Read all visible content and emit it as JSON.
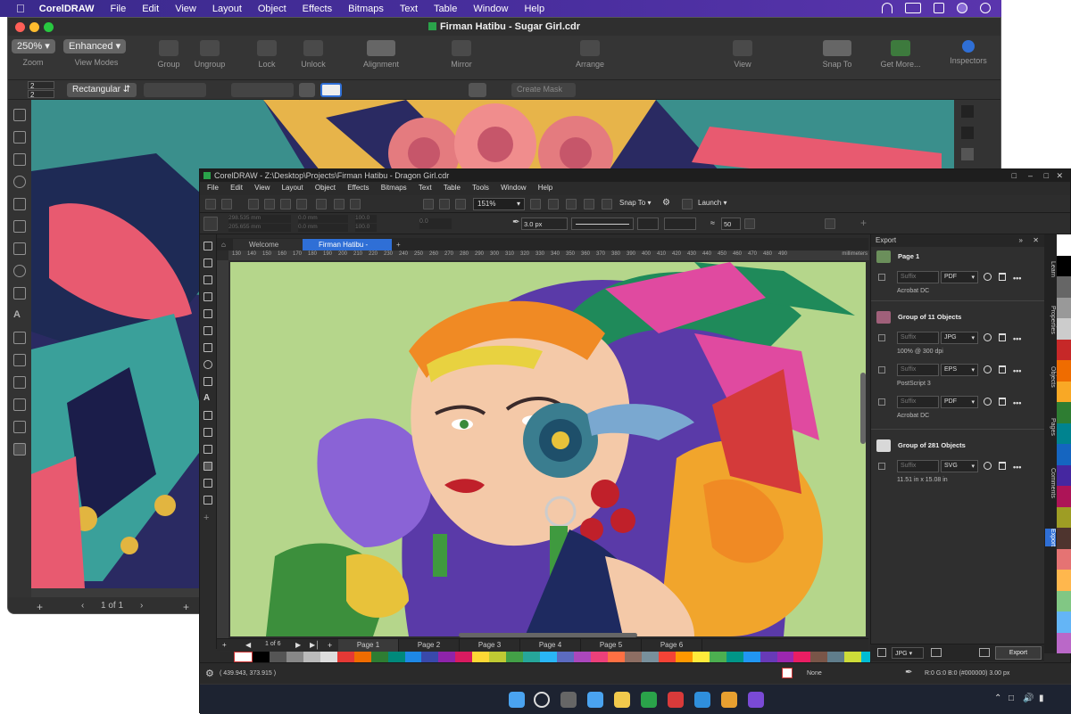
{
  "mac": {
    "menubar": [
      "CorelDRAW",
      "File",
      "Edit",
      "View",
      "Layout",
      "Object",
      "Effects",
      "Bitmaps",
      "Text",
      "Table",
      "Window",
      "Help"
    ],
    "title": "Firman Hatibu - Sugar Girl.cdr",
    "zoom": "250%",
    "viewmode": "Enhanced",
    "toolbar": [
      "Zoom",
      "View Modes",
      "Group",
      "Ungroup",
      "Lock",
      "Unlock",
      "Alignment",
      "Mirror",
      "Arrange",
      "View",
      "Snap To",
      "Get More...",
      "Inspectors"
    ],
    "shape_dropdown": "Rectangular",
    "num_a": "2",
    "num_b": "2",
    "create_mask": "Create Mask",
    "page_indicator": "1 of 1"
  },
  "win": {
    "title": "CorelDRAW - Z:\\Desktop\\Projects\\Firman Hatibu - Dragon Girl.cdr",
    "menu": [
      "File",
      "Edit",
      "View",
      "Layout",
      "Object",
      "Effects",
      "Bitmaps",
      "Text",
      "Table",
      "Tools",
      "Window",
      "Help"
    ],
    "zoom": "151%",
    "snap": "Snap To",
    "launch": "Launch",
    "x": "298.535 mm",
    "y": "205.655 mm",
    "w": "0.0 mm",
    "h": "0.0 mm",
    "sx": "100.0",
    "sy": "100.0",
    "rot": "0.0",
    "outline": "3.0 px",
    "smooth": "50",
    "tabs": [
      "Welcome Screen",
      "Firman Hatibu - Dragon..."
    ],
    "ruler_ticks": [
      "130",
      "140",
      "150",
      "160",
      "170",
      "180",
      "190",
      "200",
      "210",
      "220",
      "230",
      "240",
      "250",
      "260",
      "270",
      "280",
      "290",
      "300",
      "310",
      "320",
      "330",
      "340",
      "350",
      "360",
      "370",
      "380",
      "390",
      "400",
      "410",
      "420",
      "430",
      "440",
      "450",
      "460",
      "470",
      "480",
      "490"
    ],
    "ruler_unit": "millimeters",
    "page_nav": "1 of 6",
    "pages": [
      "Page 1",
      "Page 2",
      "Page 3",
      "Page 4",
      "Page 5",
      "Page 6"
    ],
    "status_coords": "( 439.943, 373.915 )",
    "fill": "None",
    "outline_status": "R:0 G:0 B:0 (#000000)  3.00 px"
  },
  "export": {
    "header": "Export",
    "groups": [
      {
        "title": "Page 1",
        "rows": [
          {
            "suffix": "Suffix",
            "fmt": "PDF",
            "sub": "Acrobat DC"
          }
        ]
      },
      {
        "title": "Group of 11 Objects",
        "rows": [
          {
            "suffix": "Suffix",
            "fmt": "JPG",
            "sub": "100% @ 300 dpi"
          },
          {
            "suffix": "Suffix",
            "fmt": "EPS",
            "sub": "PostScript 3"
          },
          {
            "suffix": "Suffix",
            "fmt": "PDF",
            "sub": "Acrobat DC"
          }
        ]
      },
      {
        "title": "Group of 281 Objects",
        "rows": [
          {
            "suffix": "Suffix",
            "fmt": "SVG",
            "sub": "11.51 in x 15.08 in"
          }
        ]
      }
    ],
    "footer_fmt": "JPG",
    "footer_btn": "Export"
  },
  "side_tabs": [
    "Learn",
    "Properties",
    "Objects",
    "Pages",
    "Comments",
    "Export"
  ],
  "colors": {
    "accent": "#2f6fd6",
    "canvas_bg": "#b5d68b"
  }
}
